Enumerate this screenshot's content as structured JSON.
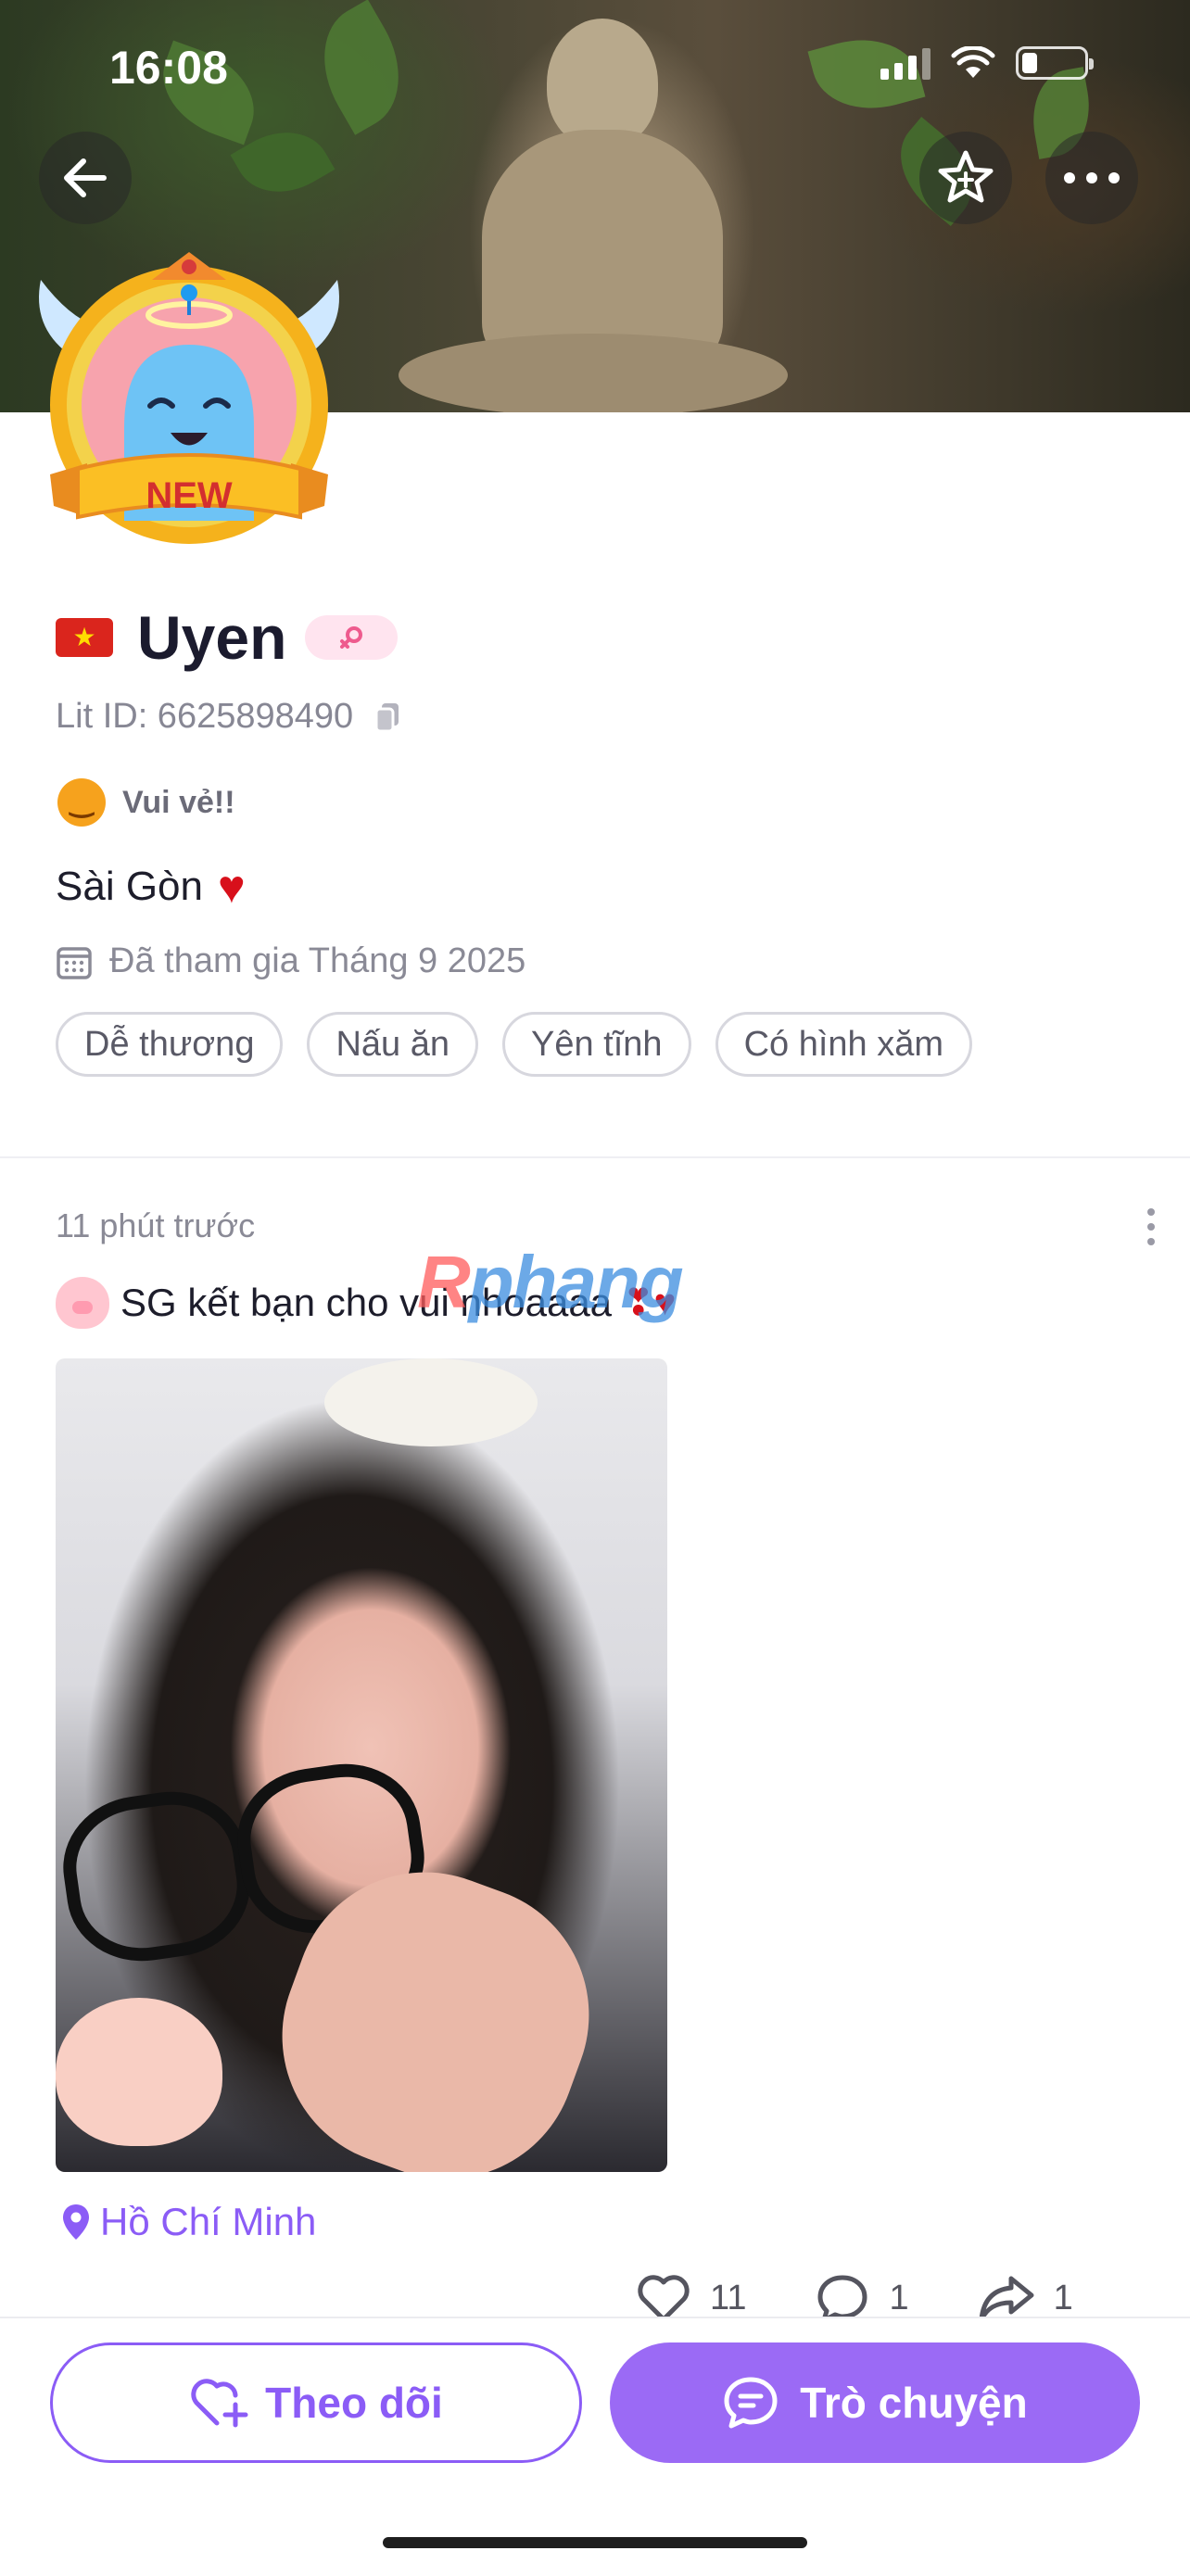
{
  "status_bar": {
    "time": "16:08"
  },
  "profile": {
    "badge_label": "NEW",
    "name": "Uyen",
    "lit_id": "Lit ID: 6625898490",
    "mood": "Vui vẻ!!",
    "bio": "Sài Gòn",
    "joined": "Đã tham gia Tháng 9 2025",
    "tags": [
      "Dễ thương",
      "Nấu ăn",
      "Yên tĩnh",
      "Có hình xăm"
    ]
  },
  "post": {
    "time_ago": "11 phút trước",
    "text": "SG kết bạn cho vui nhoaaaa",
    "location": "Hồ Chí Minh",
    "likes": "11",
    "comments": "1",
    "shares": "1"
  },
  "watermark": {
    "prefix": "R",
    "text": "phang"
  },
  "actions": {
    "follow_label": "Theo dõi",
    "chat_label": "Trò chuyện"
  },
  "colors": {
    "accent": "#8b5cf6",
    "chat_button": "#9b6af5",
    "heart": "#d8101b"
  }
}
